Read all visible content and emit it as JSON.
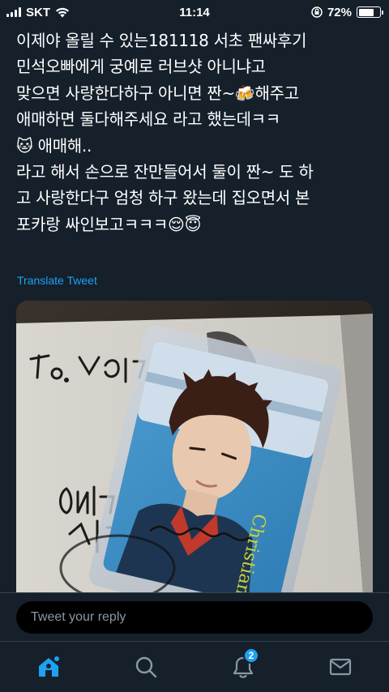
{
  "status_bar": {
    "carrier": "SKT",
    "time": "11:14",
    "battery_percent": "72%",
    "battery_level": 0.72
  },
  "tweet": {
    "text": "이제야 올릴 수 있는181118 서초 팬싸후기\n민석오빠에게 궁예로 러브샷 아니냐고\n맞으면 사랑한다하구 아니면 짠~🍻해주고\n애매하면 둘다해주세요 라고 했는데ㅋㅋ\n🐱 애매해..\n라고 해서 손으로 잔만들어서 둘이 짠~ 도 하\n고 사랑한다구 엄청 하구 왔는데 집오면서 본\n포카랑 싸인보고ㅋㅋㅋ😌😇",
    "translate_label": "Translate Tweet"
  },
  "photo": {
    "signature_lines": [
      "To. 사랑하는",
      "어쩌구",
      "사랑"
    ],
    "card_text": "Christian Dior"
  },
  "reply": {
    "placeholder": "Tweet your reply"
  },
  "tab_bar": {
    "notification_count": "2",
    "tabs": [
      "home-icon",
      "search-icon",
      "notifications-icon",
      "messages-icon"
    ],
    "accent_color": "#1da1f2"
  }
}
